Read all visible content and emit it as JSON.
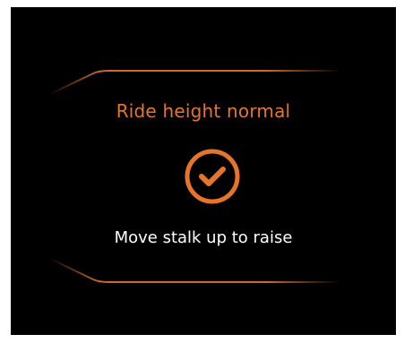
{
  "popup": {
    "title": "Ride height normal",
    "message": "Move stalk up to raise",
    "status_icon": "checkmark-circle-icon"
  },
  "colors": {
    "background": "#000000",
    "accent": "#E8742A",
    "text": "#FFFFFF"
  }
}
